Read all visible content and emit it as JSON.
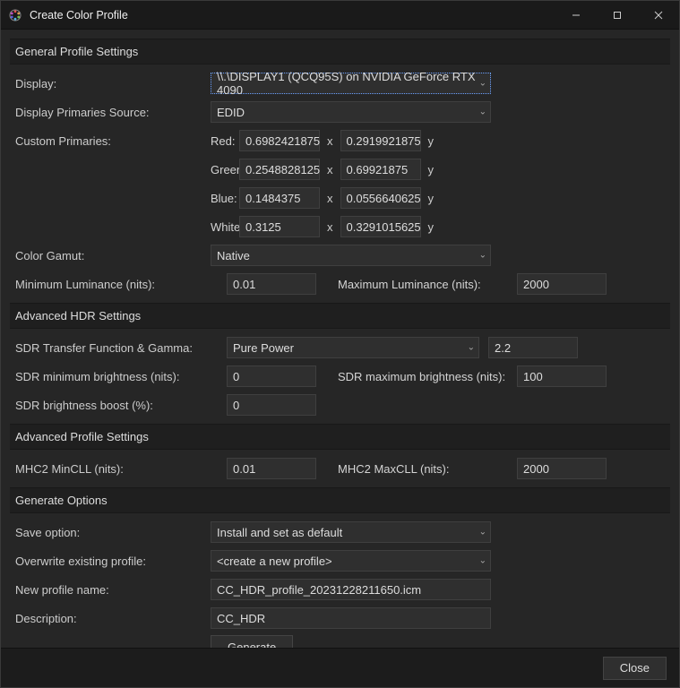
{
  "window": {
    "title": "Create Color Profile"
  },
  "sections": {
    "general": "General Profile Settings",
    "hdr": "Advanced HDR Settings",
    "advprofile": "Advanced Profile Settings",
    "generate": "Generate Options"
  },
  "labels": {
    "display": "Display:",
    "primariesSource": "Display Primaries Source:",
    "customPrimaries": "Custom Primaries:",
    "red": "Red:",
    "green": "Green:",
    "blue": "Blue:",
    "white": "White:",
    "colorGamut": "Color Gamut:",
    "minLum": "Minimum Luminance (nits):",
    "maxLum": "Maximum Luminance (nits):",
    "sdrTransfer": "SDR Transfer Function & Gamma:",
    "sdrMinB": "SDR minimum brightness (nits):",
    "sdrMaxB": "SDR maximum brightness (nits):",
    "sdrBoost": "SDR brightness boost (%):",
    "mhc2min": "MHC2 MinCLL (nits):",
    "mhc2max": "MHC2 MaxCLL (nits):",
    "saveOption": "Save option:",
    "overwrite": "Overwrite existing profile:",
    "newProfile": "New profile name:",
    "description": "Description:",
    "x": "x",
    "y": "y"
  },
  "values": {
    "display": "\\\\.\\DISPLAY1 (QCQ95S) on NVIDIA GeForce RTX 4090",
    "primariesSource": "EDID",
    "red_x": "0.6982421875",
    "red_y": "0.2919921875",
    "green_x": "0.2548828125",
    "green_y": "0.69921875",
    "blue_x": "0.1484375",
    "blue_y": "0.0556640625",
    "white_x": "0.3125",
    "white_y": "0.3291015625",
    "colorGamut": "Native",
    "minLum": "0.01",
    "maxLum": "2000",
    "sdrTransfer": "Pure Power",
    "sdrGamma": "2.2",
    "sdrMinB": "0",
    "sdrMaxB": "100",
    "sdrBoost": "0",
    "mhc2min": "0.01",
    "mhc2max": "2000",
    "saveOption": "Install and set as default",
    "overwrite": "<create a new profile>",
    "newProfile": "CC_HDR_profile_20231228211650.icm",
    "description": "CC_HDR"
  },
  "buttons": {
    "generate": "Generate",
    "close": "Close"
  }
}
